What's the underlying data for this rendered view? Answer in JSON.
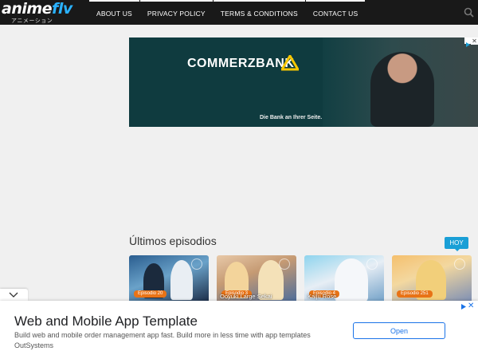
{
  "header": {
    "logo": {
      "main": "anime",
      "accent": "flv",
      "subtitle": "アニメーション"
    },
    "nav": [
      {
        "label": "ABOUT US"
      },
      {
        "label": "PRIVACY POLICY"
      },
      {
        "label": "TERMS & CONDITIONS"
      },
      {
        "label": "CONTACT US"
      }
    ],
    "search_icon": "search-icon"
  },
  "ad_banner": {
    "brand": "COMMERZBANK",
    "slogan": "Die Bank an Ihrer Seite.",
    "close_symbol": "✕"
  },
  "episodes_section": {
    "title": "Últimos episodios",
    "badge": "HOY",
    "cards": [
      {
        "episode": "Episodio 20",
        "title": ""
      },
      {
        "episode": "Episodio 3",
        "title": "Ooyuki Large Sekai"
      },
      {
        "episode": "Episodio 4",
        "title": "Kaiju Rose"
      },
      {
        "episode": "Episodio 251",
        "title": ""
      }
    ]
  },
  "bottom_ad": {
    "title": "Web and Mobile App Template",
    "description": "Build web and mobile order management app fast. Build more in less time with app templates OutSystems",
    "button": "Open",
    "close_symbol": "✕"
  },
  "colors": {
    "header_bg": "#191919",
    "brand_blue": "#2ab2ff",
    "badge_blue": "#1a9fd6",
    "episode_orange": "#e87316",
    "ad_button_blue": "#1a73e8"
  }
}
